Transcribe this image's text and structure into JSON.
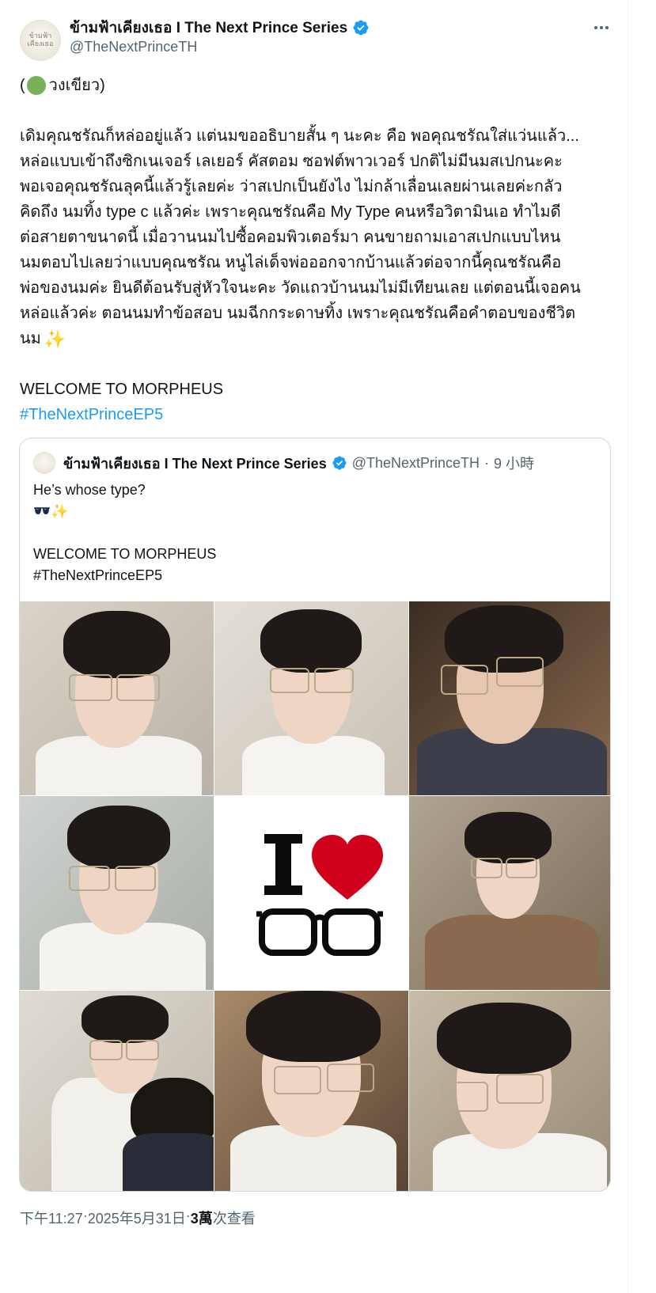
{
  "author": {
    "display_name": "ข้ามฟ้าเคียงเธอ I The Next Prince Series",
    "handle": "@TheNextPrinceTH",
    "avatar_text": "ข้ามฟ้า\nเคียงเธอ",
    "verified": true
  },
  "tweet": {
    "intro_open": "(",
    "intro_text": " วงเขียว)",
    "lines": [
      "เดิมคุณชรัณก็หล่ออยู่แล้ว แต่นมขออธิบายสั้น ๆ นะคะ คือ พอคุณชรัณใส่แว่นแล้ว...",
      "หล่อแบบเข้าถึงซิกเนเจอร์ เลเยอร์ คัสตอม ซอฟต์พาวเวอร์ ปกติไม่มีนมสเปกนะคะ",
      "พอเจอคุณชรัณลุคนี้แล้วรู้เลยค่ะ ว่าสเปกเป็นยังไง ไม่กล้าเลื่อนเลยผ่านเลยค่ะกลัว",
      "คิดถึง นมทิ้ง type c แล้วค่ะ เพราะคุณชรัณคือ My Type คนหรือวิตามินเอ ทำไมดี",
      "ต่อสายตาขนาดนี้ เมื่อวานนมไปซื้อคอมพิวเตอร์มา คนขายถามเอาสเปกแบบไหน",
      "นมตอบไปเลยว่าแบบคุณชรัณ หนูไล่เด็จพ่อออกจากบ้านแล้วต่อจากนี้คุณชรัณคือ",
      "พ่อของนมค่ะ ยินดีต้อนรับสู่หัวใจนะคะ วัดแถวบ้านนมไม่มีเทียนเลย แต่ตอนนี้เจอคน",
      "หล่อแล้วค่ะ ตอนนมทำข้อสอบ นมฉีกกระดาษทิ้ง เพราะคุณชรัณคือคำตอบของชีวิต"
    ],
    "last_line": "นม",
    "sparkle": "✨",
    "welcome": "WELCOME TO MORPHEUS",
    "hashtag": "#TheNextPrinceEP5"
  },
  "quote": {
    "display_name": "ข้ามฟ้าเคียงเธอ I The Next Prince Series",
    "handle": "@TheNextPrinceTH",
    "separator": "·",
    "time": "9 小時",
    "line1": "He’s whose type?",
    "sparkle": "✨",
    "welcome": "WELCOME TO MORPHEUS",
    "hashtag": "#TheNextPrinceEP5"
  },
  "footer": {
    "time": "下午11:27",
    "sep1": " · ",
    "date": "2025年5月31日",
    "sep2": " · ",
    "views_count": "3萬",
    "views_label": " 次查看"
  },
  "colors": {
    "text": "#0f1419",
    "secondary": "#536471",
    "link": "#1d9bf0",
    "verified": "#1d9bf0",
    "heart": "#d0021b"
  }
}
